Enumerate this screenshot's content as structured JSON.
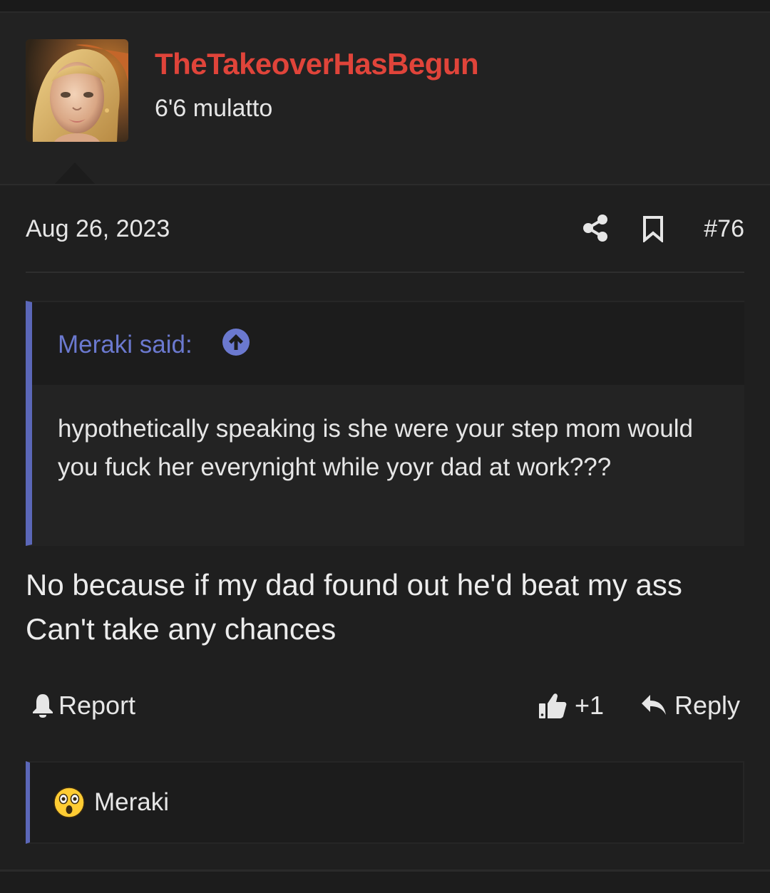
{
  "user": {
    "name": "TheTakeoverHasBegun",
    "title": "6'6 mulatto",
    "name_color": "#e0443a",
    "avatar_icon": "portrait-avatar"
  },
  "post": {
    "date": "Aug 26, 2023",
    "number": "#76",
    "body_lines": [
      "No because if my dad found out he'd beat my ass",
      "Can't take any chances"
    ]
  },
  "quote": {
    "author": "Meraki said:",
    "text": "hypothetically speaking is she were your step mom would you fuck her everynight while yoyr dad at work???",
    "accent_color": "#5b67b8"
  },
  "actions": {
    "report_label": "Report",
    "like_count": "+1",
    "reply_label": "Reply"
  },
  "reactions": {
    "emoji_icon": "astonished-face-icon",
    "user": "Meraki"
  }
}
